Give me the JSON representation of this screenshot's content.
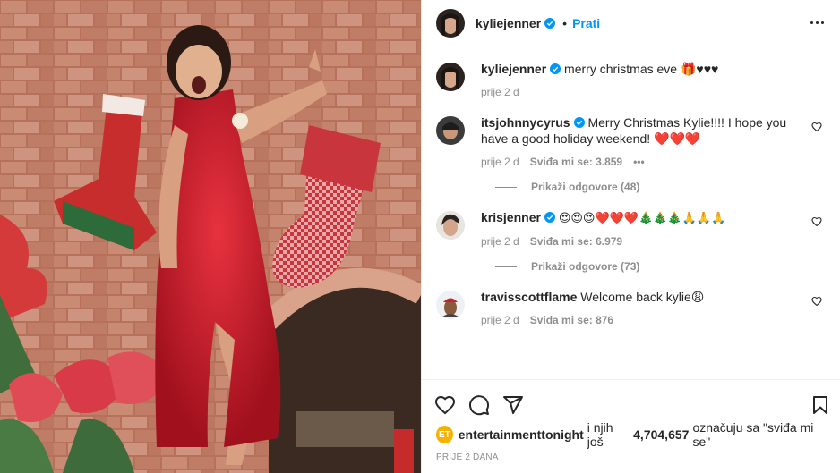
{
  "post": {
    "author": "kyliejenner",
    "follow_label": "Prati",
    "separator": "•",
    "caption_text": "merry christmas eve 🎁♥♥♥",
    "caption_time": "prije 2 d"
  },
  "comments": [
    {
      "user": "itsjohnnycyrus",
      "text": "Merry Christmas Kylie!!!! I hope you have a good holiday weekend! ❤️❤️❤️",
      "time": "prije 2 d",
      "likes": "Sviđa mi se: 3.859",
      "options": "•••",
      "replies": "Prikaži odgovore (48)"
    },
    {
      "user": "krisjenner",
      "text": "😍😍😍❤️❤️❤️🎄🎄🎄🙏🙏🙏",
      "time": "prije 2 d",
      "likes": "Sviđa mi se: 6.979",
      "replies": "Prikaži odgovore (73)"
    },
    {
      "user": "travisscottflame",
      "text": "Welcome back kylie😩",
      "time": "prije 2 d",
      "likes": "Sviđa mi se: 876"
    }
  ],
  "likes_line": {
    "badge": "ET",
    "user": "entertainmenttonight",
    "middle": "i njih još",
    "count": "4,704,657",
    "suffix": "označuju sa \"sviđa mi se\""
  },
  "date_label": "PRIJE 2 DANA",
  "icons": [
    "verified-icon",
    "more-options-icon",
    "heart-icon",
    "comment-icon",
    "share-icon",
    "bookmark-icon"
  ],
  "colors": {
    "accent": "#0095f6",
    "muted": "#8e8e8e",
    "text": "#262626",
    "dress": "#c8192a"
  }
}
